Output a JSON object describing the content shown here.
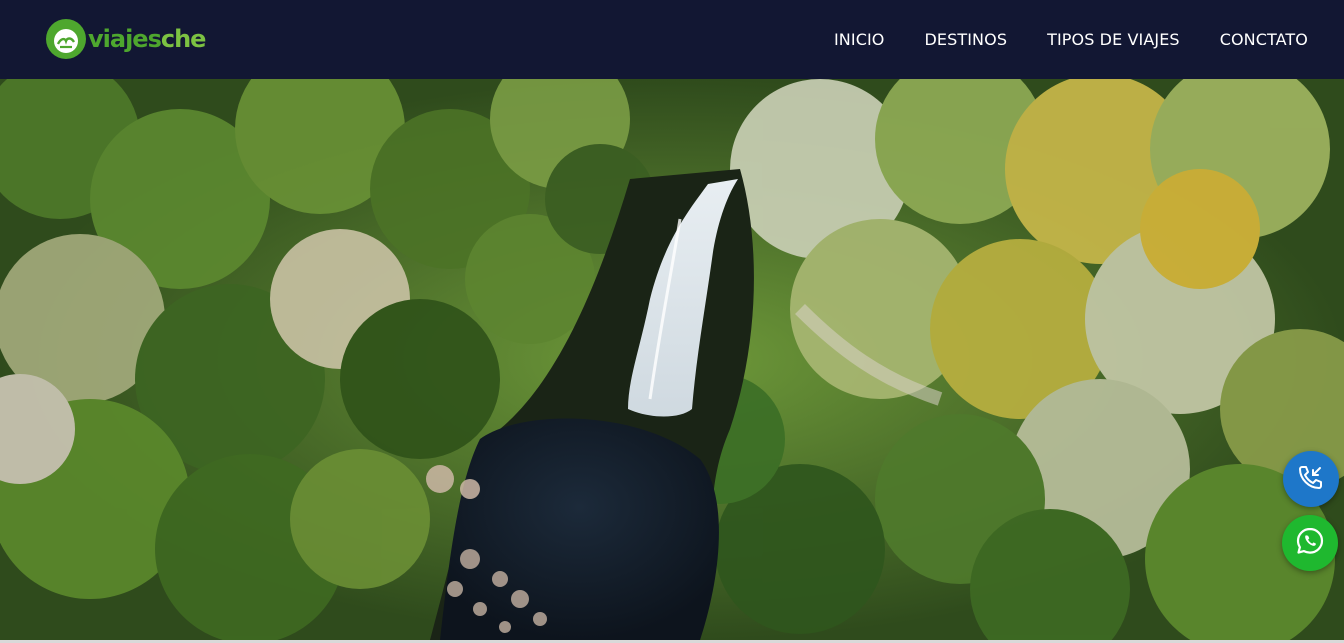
{
  "brand": {
    "name_part1": "viajes",
    "name_part2": "che",
    "colors": {
      "primary_green": "#4ea72e",
      "light_green": "#7cc242",
      "header_bg": "#121733"
    }
  },
  "nav": {
    "items": [
      {
        "label": "INICIO"
      },
      {
        "label": "DESTINOS"
      },
      {
        "label": "TIPOS DE VIAJES"
      },
      {
        "label": "CONCTATO"
      }
    ]
  },
  "hero": {
    "image": "aerial-waterfall-forest"
  },
  "floating_buttons": {
    "call": {
      "icon": "phone-call-icon",
      "color": "#1e77c9"
    },
    "whatsapp": {
      "icon": "whatsapp-icon",
      "color": "#1fb82f"
    }
  }
}
